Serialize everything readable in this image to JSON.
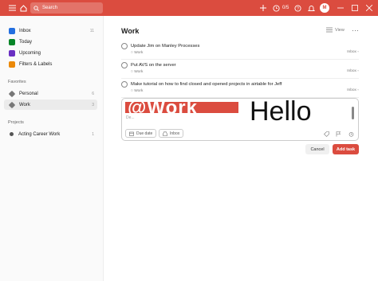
{
  "topbar": {
    "search_placeholder": "Search",
    "karma": "0/5",
    "avatar_initial": "M"
  },
  "sidebar": {
    "items": [
      {
        "label": "Inbox",
        "count": "11",
        "color": "#246fe0"
      },
      {
        "label": "Today",
        "count": "",
        "color": "#058527"
      },
      {
        "label": "Upcoming",
        "count": "",
        "color": "#692fc2"
      },
      {
        "label": "Filters & Labels",
        "count": "",
        "color": "#eb8909"
      }
    ],
    "favorites_title": "Favorites",
    "favorites": [
      {
        "label": "Personal",
        "count": "6"
      },
      {
        "label": "Work",
        "count": "3"
      }
    ],
    "projects_title": "Projects",
    "projects": [
      {
        "label": "Acting Career Work",
        "count": "1"
      }
    ]
  },
  "main": {
    "title": "Work",
    "view_label": "View",
    "tasks": [
      {
        "title": "Update Jim on Manley Processes",
        "project": "Work",
        "source": "Inbox"
      },
      {
        "title": "Put AVS on the server",
        "project": "Work",
        "source": "Inbox"
      },
      {
        "title": "Make tutorial on how to find closed and opened projects in airtable for Jeff",
        "project": "Work",
        "source": "Inbox"
      }
    ]
  },
  "editor": {
    "banner_text": "@Work",
    "big_text": "Hello",
    "description": "De...",
    "due_date_label": "Due date",
    "inbox_label": "Inbox"
  },
  "actions": {
    "cancel_label": "Cancel",
    "add_task_label": "Add task"
  },
  "colors": {
    "brand": "#db4c3f"
  }
}
